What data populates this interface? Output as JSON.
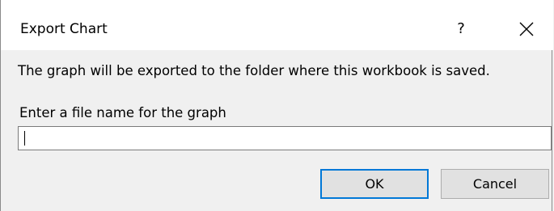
{
  "window": {
    "title": "Export Chart",
    "help_label": "?",
    "close_icon": "close-icon"
  },
  "body": {
    "message": "The graph will be exported to the folder where this workbook is saved.",
    "field_label": "Enter a file name for the graph",
    "filename_value": "",
    "filename_placeholder": ""
  },
  "buttons": {
    "ok_label": "OK",
    "cancel_label": "Cancel"
  },
  "colors": {
    "dialog_background": "#f0f0f0",
    "titlebar_background": "#ffffff",
    "default_button_border": "#0078d7",
    "button_background": "#e1e1e1"
  }
}
